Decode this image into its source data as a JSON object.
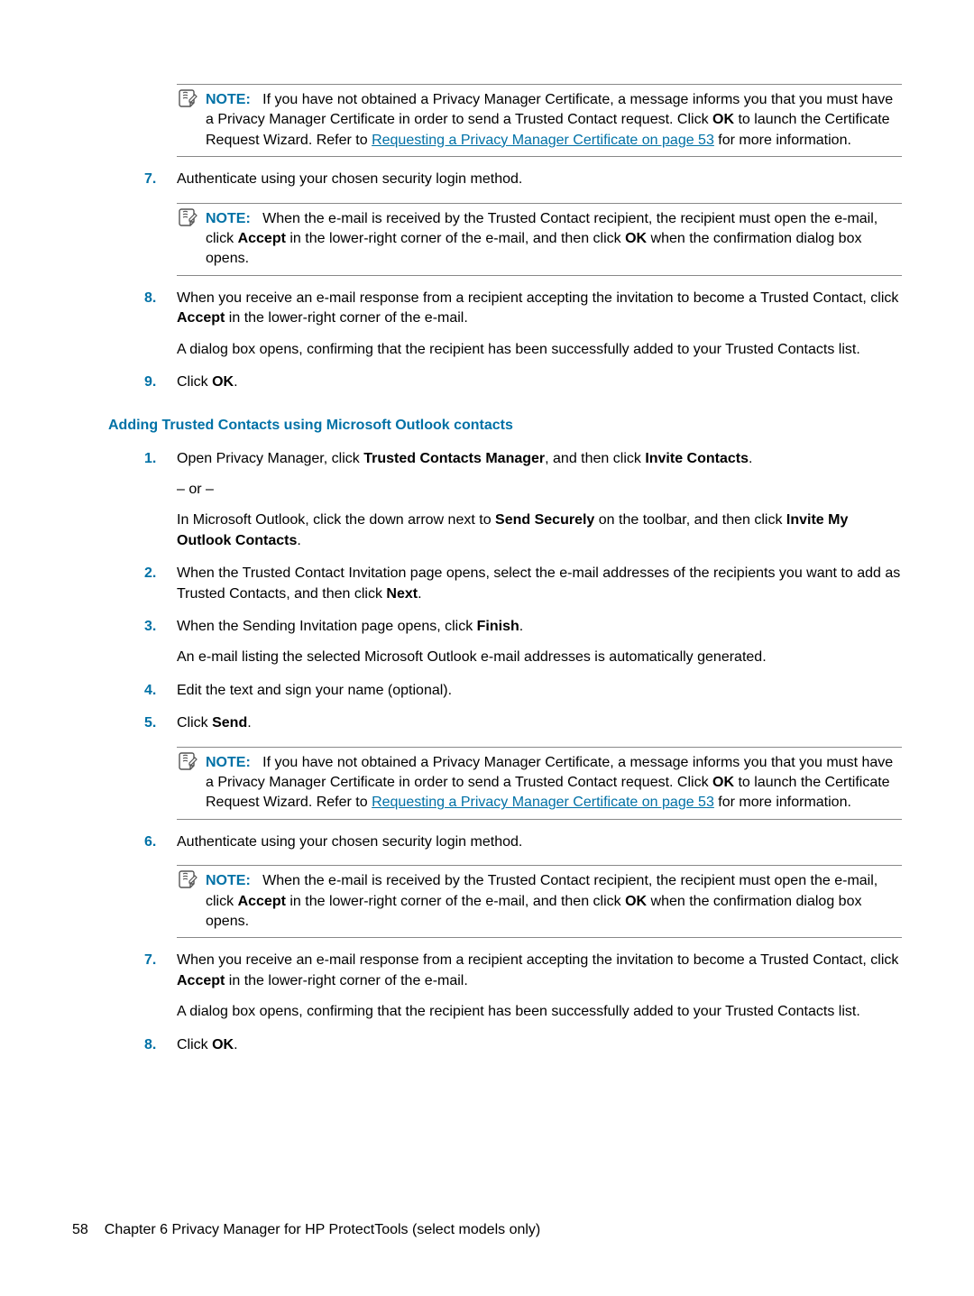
{
  "note1": {
    "label": "NOTE:",
    "t1": "If you have not obtained a Privacy Manager Certificate, a message informs you that you must have a Privacy Manager Certificate in order to send a Trusted Contact request. Click ",
    "b1": "OK",
    "t2": " to launch the Certificate Request Wizard. Refer to ",
    "link": "Requesting a Privacy Manager Certificate on page 53",
    "t3": " for more information."
  },
  "step7a": {
    "num": "7.",
    "text": "Authenticate using your chosen security login method."
  },
  "note2": {
    "label": "NOTE:",
    "t1": "When the e-mail is received by the Trusted Contact recipient, the recipient must open the e-mail, click ",
    "b1": "Accept",
    "t2": " in the lower-right corner of the e-mail, and then click ",
    "b2": "OK",
    "t3": " when the confirmation dialog box opens."
  },
  "step8a": {
    "num": "8.",
    "t1": "When you receive an e-mail response from a recipient accepting the invitation to become a Trusted Contact, click ",
    "b1": "Accept",
    "t2": " in the lower-right corner of the e-mail.",
    "p2": "A dialog box opens, confirming that the recipient has been successfully added to your Trusted Contacts list."
  },
  "step9a": {
    "num": "9.",
    "t1": "Click ",
    "b1": "OK",
    "t2": "."
  },
  "heading": "Adding Trusted Contacts using Microsoft Outlook contacts",
  "step1b": {
    "num": "1.",
    "t1": "Open Privacy Manager, click ",
    "b1": "Trusted Contacts Manager",
    "t2": ", and then click ",
    "b2": "Invite Contacts",
    "t3": ".",
    "or": "– or –",
    "t4": "In Microsoft Outlook, click the down arrow next to ",
    "b3": "Send Securely",
    "t5": " on the toolbar, and then click ",
    "b4": "Invite My Outlook Contacts",
    "t6": "."
  },
  "step2b": {
    "num": "2.",
    "t1": "When the Trusted Contact Invitation page opens, select the e-mail addresses of the recipients you want to add as Trusted Contacts, and then click ",
    "b1": "Next",
    "t2": "."
  },
  "step3b": {
    "num": "3.",
    "t1": "When the Sending Invitation page opens, click ",
    "b1": "Finish",
    "t2": ".",
    "p2": "An e-mail listing the selected Microsoft Outlook e-mail addresses is automatically generated."
  },
  "step4b": {
    "num": "4.",
    "text": "Edit the text and sign your name (optional)."
  },
  "step5b": {
    "num": "5.",
    "t1": "Click ",
    "b1": "Send",
    "t2": "."
  },
  "note3": {
    "label": "NOTE:",
    "t1": "If you have not obtained a Privacy Manager Certificate, a message informs you that you must have a Privacy Manager Certificate in order to send a Trusted Contact request. Click ",
    "b1": "OK",
    "t2": " to launch the Certificate Request Wizard. Refer to ",
    "link": "Requesting a Privacy Manager Certificate on page 53",
    "t3": " for more information."
  },
  "step6b": {
    "num": "6.",
    "text": "Authenticate using your chosen security login method."
  },
  "note4": {
    "label": "NOTE:",
    "t1": "When the e-mail is received by the Trusted Contact recipient, the recipient must open the e-mail, click ",
    "b1": "Accept",
    "t2": " in the lower-right corner of the e-mail, and then click ",
    "b2": "OK",
    "t3": " when the confirmation dialog box opens."
  },
  "step7b": {
    "num": "7.",
    "t1": "When you receive an e-mail response from a recipient accepting the invitation to become a Trusted Contact, click ",
    "b1": "Accept",
    "t2": " in the lower-right corner of the e-mail.",
    "p2": "A dialog box opens, confirming that the recipient has been successfully added to your Trusted Contacts list."
  },
  "step8b": {
    "num": "8.",
    "t1": "Click ",
    "b1": "OK",
    "t2": "."
  },
  "footer": {
    "page": "58",
    "chapter": "Chapter 6   Privacy Manager for HP ProtectTools (select models only)"
  }
}
